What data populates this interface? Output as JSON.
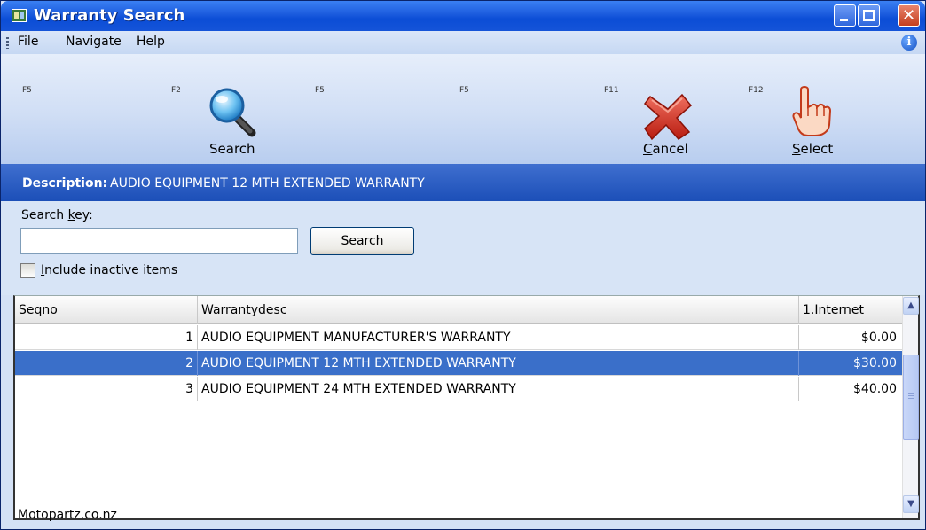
{
  "window": {
    "title": "Warranty Search"
  },
  "menu": {
    "items": [
      "File",
      "Navigate",
      "Help"
    ]
  },
  "toolbar": {
    "fkeys": [
      "F5",
      "F2",
      "F5",
      "F5",
      "F11",
      "F12"
    ],
    "search_label": "Search",
    "cancel_label_u": "C",
    "cancel_label_rest": "ancel",
    "select_label_u": "S",
    "select_label_rest": "elect"
  },
  "description": {
    "label": "Description:",
    "value": "AUDIO EQUIPMENT 12 MTH EXTENDED WARRANTY"
  },
  "search": {
    "key_label_pre": "Search ",
    "key_label_u": "k",
    "key_label_post": "ey:",
    "input_value": "",
    "button_label": "Search",
    "include_inactive_u": "I",
    "include_inactive_rest": "nclude inactive items",
    "include_inactive_checked": false
  },
  "grid": {
    "columns": [
      "Seqno",
      "Warrantydesc",
      "1.Internet"
    ],
    "rows": [
      {
        "seqno": "1",
        "desc": "AUDIO EQUIPMENT MANUFACTURER'S WARRANTY",
        "price": "$0.00"
      },
      {
        "seqno": "2",
        "desc": "AUDIO EQUIPMENT 12 MTH EXTENDED WARRANTY",
        "price": "$30.00"
      },
      {
        "seqno": "3",
        "desc": "AUDIO EQUIPMENT 24 MTH EXTENDED WARRANTY",
        "price": "$40.00"
      }
    ],
    "selected_row": 2
  },
  "status": {
    "text": "Motopartz.co.nz"
  },
  "colors": {
    "selection": "#3a6fc9",
    "titlebar": "#0b4dd6",
    "description_bar": "#1c4fb8"
  }
}
